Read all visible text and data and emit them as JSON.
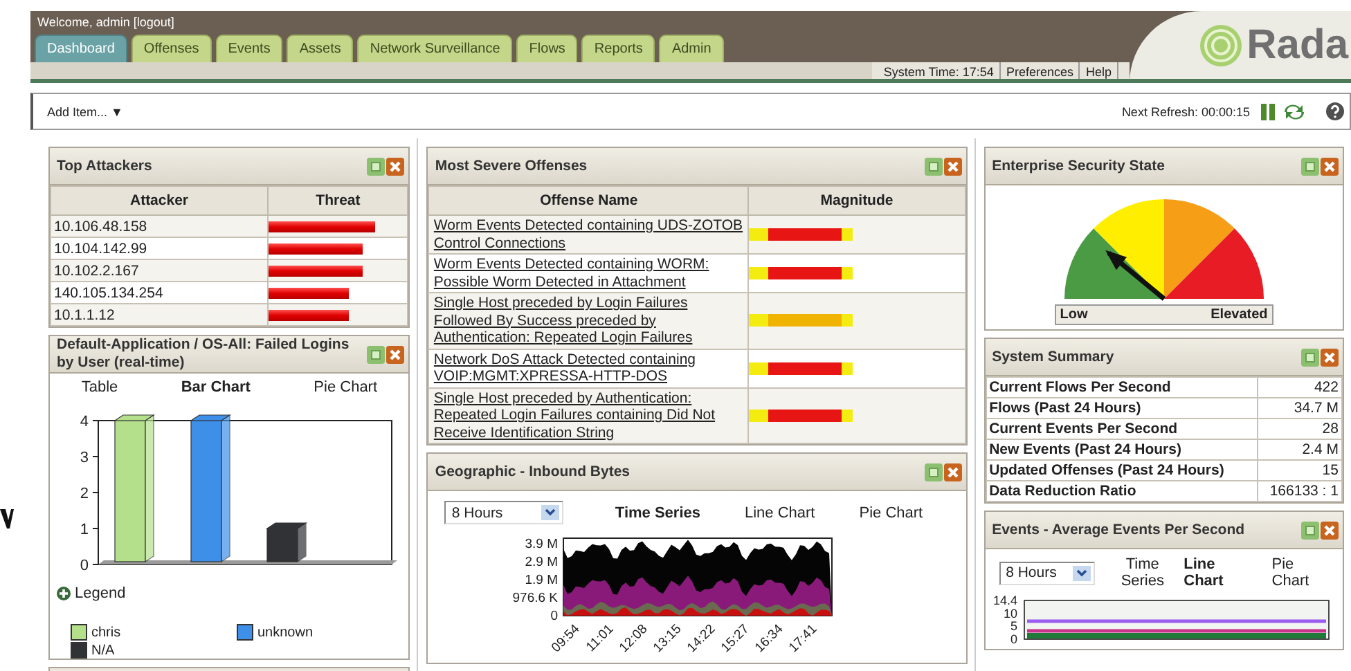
{
  "header": {
    "welcome": "Welcome, admin [logout]",
    "tabs": [
      {
        "label": "Dashboard",
        "selected": true
      },
      {
        "label": "Offenses",
        "selected": false
      },
      {
        "label": "Events",
        "selected": false
      },
      {
        "label": "Assets",
        "selected": false
      },
      {
        "label": "Network Surveillance",
        "selected": false
      },
      {
        "label": "Flows",
        "selected": false
      },
      {
        "label": "Reports",
        "selected": false
      },
      {
        "label": "Admin",
        "selected": false
      }
    ],
    "system_time": "System Time: 17:54",
    "links": [
      "Preferences",
      "Help"
    ],
    "logo_text": "Rada"
  },
  "toolbar": {
    "add_item": "Add Item... ▼",
    "next_refresh": "Next Refresh: 00:00:15"
  },
  "top_attackers": {
    "title": "Top Attackers",
    "columns": [
      "Attacker",
      "Threat"
    ],
    "rows": [
      {
        "attacker": "10.106.48.158",
        "level": 0.77
      },
      {
        "attacker": "10.104.142.99",
        "level": 0.68
      },
      {
        "attacker": "10.102.2.167",
        "level": 0.68
      },
      {
        "attacker": "140.105.134.254",
        "level": 0.58
      },
      {
        "attacker": "10.1.1.12",
        "level": 0.58
      }
    ]
  },
  "failed_logins": {
    "title": "Default-Application / OS-All: Failed Logins by User (real-time)",
    "views": [
      {
        "label": "Table",
        "selected": false
      },
      {
        "label": "Bar Chart",
        "selected": true
      },
      {
        "label": "Pie Chart",
        "selected": false
      }
    ],
    "y_labels": [
      "4",
      "3",
      "2",
      "1",
      "0"
    ],
    "legend_toggle": "Legend",
    "legend": [
      {
        "label": "chris",
        "color": "#b4e08c"
      },
      {
        "label": "unknown",
        "color": "#3d8fe8"
      },
      {
        "label": "N/A",
        "color": "#303236"
      }
    ]
  },
  "severe_offenses": {
    "title": "Most Severe Offenses",
    "columns": [
      "Offense Name",
      "Magnitude"
    ],
    "rows": [
      {
        "name": "Worm Events Detected containing UDS-ZOTOB Control Connections",
        "color": "#e81515"
      },
      {
        "name": "Worm Events Detected containing WORM: Possible Worm Detected in Attachment",
        "color": "#e81515"
      },
      {
        "name": "Single Host preceded by Login Failures Followed By Success preceded by Authentication: Repeated Login Failures",
        "color": "#f0b400"
      },
      {
        "name": "Network DoS Attack Detected containing VOIP:MGMT:XPRESSA-HTTP-DOS",
        "color": "#e81515"
      },
      {
        "name": "Single Host preceded by Authentication: Repeated Login Failures containing Did Not Receive Identification String",
        "color": "#e81515"
      }
    ]
  },
  "geographic": {
    "title": "Geographic - Inbound Bytes",
    "range": "8 Hours",
    "views": [
      {
        "label": "Time Series",
        "selected": true
      },
      {
        "label": "Line Chart",
        "selected": false
      },
      {
        "label": "Pie Chart",
        "selected": false
      }
    ],
    "y_labels": [
      "3.9 M",
      "2.9 M",
      "1.9 M",
      "976.6 K",
      "0"
    ],
    "x_labels": [
      "09:54",
      "11:01",
      "12:08",
      "13:15",
      "14:22",
      "15:27",
      "16:34",
      "17:41"
    ]
  },
  "security_state": {
    "title": "Enterprise Security State",
    "low": "Low",
    "high": "Elevated"
  },
  "system_summary": {
    "title": "System Summary",
    "rows": [
      {
        "label": "Current Flows Per Second",
        "value": "422"
      },
      {
        "label": "Flows (Past 24 Hours)",
        "value": "34.7 M"
      },
      {
        "label": "Current Events Per Second",
        "value": "28"
      },
      {
        "label": "New Events (Past 24 Hours)",
        "value": "2.4 M"
      },
      {
        "label": "Updated Offenses (Past 24 Hours)",
        "value": "15"
      },
      {
        "label": "Data Reduction Ratio",
        "value": "166133 : 1"
      }
    ]
  },
  "events_rate": {
    "title": "Events - Average Events Per Second",
    "range": "8 Hours",
    "views": [
      {
        "label": "Time Series",
        "selected": false
      },
      {
        "label": "Line Chart",
        "selected": true
      },
      {
        "label": "Pie Chart",
        "selected": false
      }
    ],
    "y_labels": [
      "14.4",
      "10",
      "5",
      "0"
    ]
  }
}
